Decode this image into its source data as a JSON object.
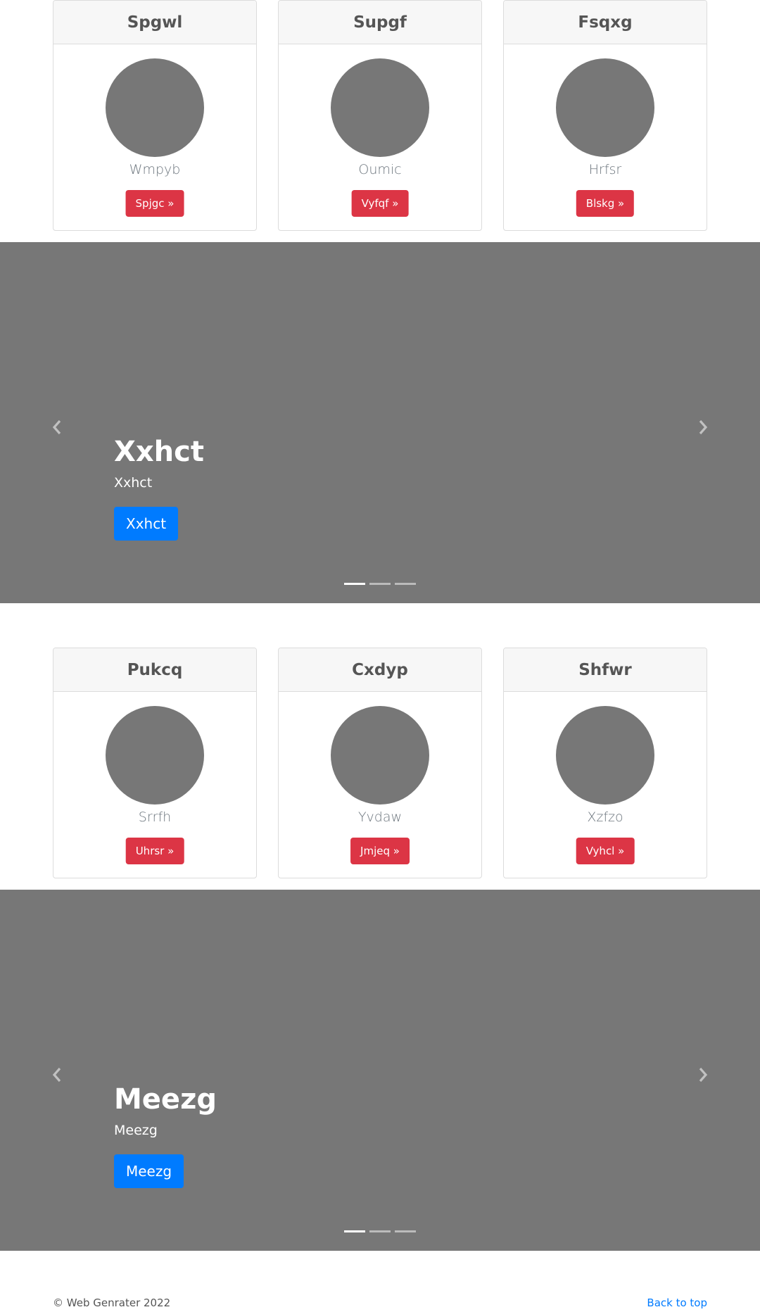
{
  "card_rows": [
    {
      "cards": [
        {
          "title": "Spgwl",
          "subtitle": "Wmpyb",
          "button": "Spjgc »"
        },
        {
          "title": "Supgf",
          "subtitle": "Oumic",
          "button": "Vyfqf »"
        },
        {
          "title": "Fsqxg",
          "subtitle": "Hrfsr",
          "button": "Blskg »"
        }
      ]
    },
    {
      "cards": [
        {
          "title": "Pukcq",
          "subtitle": "Srrfh",
          "button": "Uhrsr »"
        },
        {
          "title": "Cxdyp",
          "subtitle": "Yvdaw",
          "button": "Jmjeq »"
        },
        {
          "title": "Shfwr",
          "subtitle": "Xzfzo",
          "button": "Vyhcl »"
        }
      ]
    }
  ],
  "carousels": [
    {
      "title": "Xxhct",
      "text": "Xxhct",
      "button": "Xxhct",
      "slide_count": 3,
      "active_index": 0
    },
    {
      "title": "Meezg",
      "text": "Meezg",
      "button": "Meezg",
      "slide_count": 3,
      "active_index": 0
    }
  ],
  "footer": {
    "copyright": "© Web Genrater 2022",
    "back_to_top": "Back to top"
  },
  "colors": {
    "placeholder_gray": "#777777",
    "danger": "#dc3545",
    "primary": "#007bff"
  },
  "icons": {
    "prev": "chevron-left-icon",
    "next": "chevron-right-icon"
  }
}
